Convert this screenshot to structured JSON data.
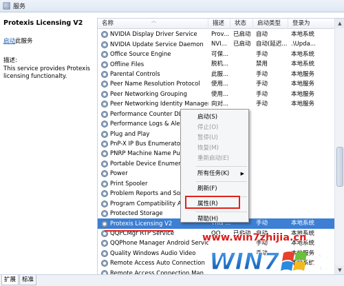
{
  "window": {
    "title": "服务"
  },
  "left_pane": {
    "service_name": "Protexis Licensing V2",
    "start_link": "启动",
    "start_suffix": "此服务",
    "description_label": "描述:",
    "description_text": "This service provides Protexis licensing functionalty."
  },
  "columns": [
    "名称",
    "描述",
    "状态",
    "启动类型",
    "登录为"
  ],
  "rows": [
    {
      "name": "NVIDIA Display Driver Service",
      "desc": "Prov...",
      "status": "已启动",
      "startup": "自动",
      "logon": "本地系统"
    },
    {
      "name": "NVIDIA Update Service Daemon",
      "desc": "NVI...",
      "status": "已启动",
      "startup": "自动(延迟...",
      "logon": ".\\Upda..."
    },
    {
      "name": "Office Source Engine",
      "desc": "可保...",
      "status": "",
      "startup": "手动",
      "logon": "本地系统"
    },
    {
      "name": "Offline Files",
      "desc": "脱机...",
      "status": "",
      "startup": "禁用",
      "logon": "本地系统"
    },
    {
      "name": "Parental Controls",
      "desc": "此服...",
      "status": "",
      "startup": "手动",
      "logon": "本地服务"
    },
    {
      "name": "Peer Name Resolution Protocol",
      "desc": "使用...",
      "status": "",
      "startup": "手动",
      "logon": "本地服务"
    },
    {
      "name": "Peer Networking Grouping",
      "desc": "使用...",
      "status": "",
      "startup": "手动",
      "logon": "本地服务"
    },
    {
      "name": "Peer Networking Identity Manager",
      "desc": "向对...",
      "status": "",
      "startup": "手动",
      "logon": "本地服务"
    },
    {
      "name": "Performance Counter DLL Host",
      "desc": "",
      "status": "",
      "startup": "",
      "logon": ""
    },
    {
      "name": "Performance Logs & Alerts",
      "desc": "",
      "status": "",
      "startup": "",
      "logon": ""
    },
    {
      "name": "Plug and Play",
      "desc": "",
      "status": "",
      "startup": "",
      "logon": ""
    },
    {
      "name": "PnP-X IP Bus Enumerator",
      "desc": "",
      "status": "",
      "startup": "",
      "logon": ""
    },
    {
      "name": "PNRP Machine Name Publication",
      "desc": "",
      "status": "",
      "startup": "",
      "logon": ""
    },
    {
      "name": "Portable Device Enumerator",
      "desc": "",
      "status": "",
      "startup": "",
      "logon": ""
    },
    {
      "name": "Power",
      "desc": "",
      "status": "",
      "startup": "",
      "logon": ""
    },
    {
      "name": "Print Spooler",
      "desc": "",
      "status": "",
      "startup": "",
      "logon": ""
    },
    {
      "name": "Problem Reports and Solutions",
      "desc": "",
      "status": "",
      "startup": "",
      "logon": ""
    },
    {
      "name": "Program Compatibility Assistant",
      "desc": "",
      "status": "",
      "startup": "",
      "logon": ""
    },
    {
      "name": "Protected Storage",
      "desc": "",
      "status": "",
      "startup": "",
      "logon": ""
    },
    {
      "name": "Protexis Licensing V2",
      "desc": "This ...",
      "status": "",
      "startup": "手动",
      "logon": "本地系统"
    },
    {
      "name": "QQPCMgr RTP Service",
      "desc": "QQ...",
      "status": "已启动",
      "startup": "自动",
      "logon": "本地系统"
    },
    {
      "name": "QQPhone Manager Android Service",
      "desc": "",
      "status": "",
      "startup": "手动",
      "logon": "本地系统"
    },
    {
      "name": "Quality Windows Audio Video",
      "desc": "",
      "status": "",
      "startup": "手动",
      "logon": "本地服务"
    },
    {
      "name": "Remote Access Auto Connection",
      "desc": "",
      "status": "",
      "startup": "",
      "logon": "本地系统"
    },
    {
      "name": "Remote Access Connection Man...",
      "desc": "",
      "status": "",
      "startup": "",
      "logon": ""
    }
  ],
  "selected_row_index": 19,
  "context_menu": {
    "items": [
      {
        "label": "启动(S)",
        "enabled": true
      },
      {
        "label": "停止(O)",
        "enabled": false
      },
      {
        "label": "暂停(U)",
        "enabled": false
      },
      {
        "label": "恢复(M)",
        "enabled": false
      },
      {
        "label": "重新启动(E)",
        "enabled": false
      },
      {
        "label": "所有任务(K)",
        "enabled": true,
        "submenu": true
      },
      {
        "label": "刷新(F)",
        "enabled": true
      },
      {
        "label": "属性(R)",
        "enabled": true,
        "highlighted": true
      },
      {
        "label": "帮助(H)",
        "enabled": true
      }
    ]
  },
  "tabs": [
    "扩展",
    "标准"
  ],
  "watermark": {
    "url": "www.win7zhijia.cn",
    "brand": "WIN7之家"
  },
  "colors": {
    "selection": "#3c7fd4",
    "highlight_border": "#e0201c"
  }
}
